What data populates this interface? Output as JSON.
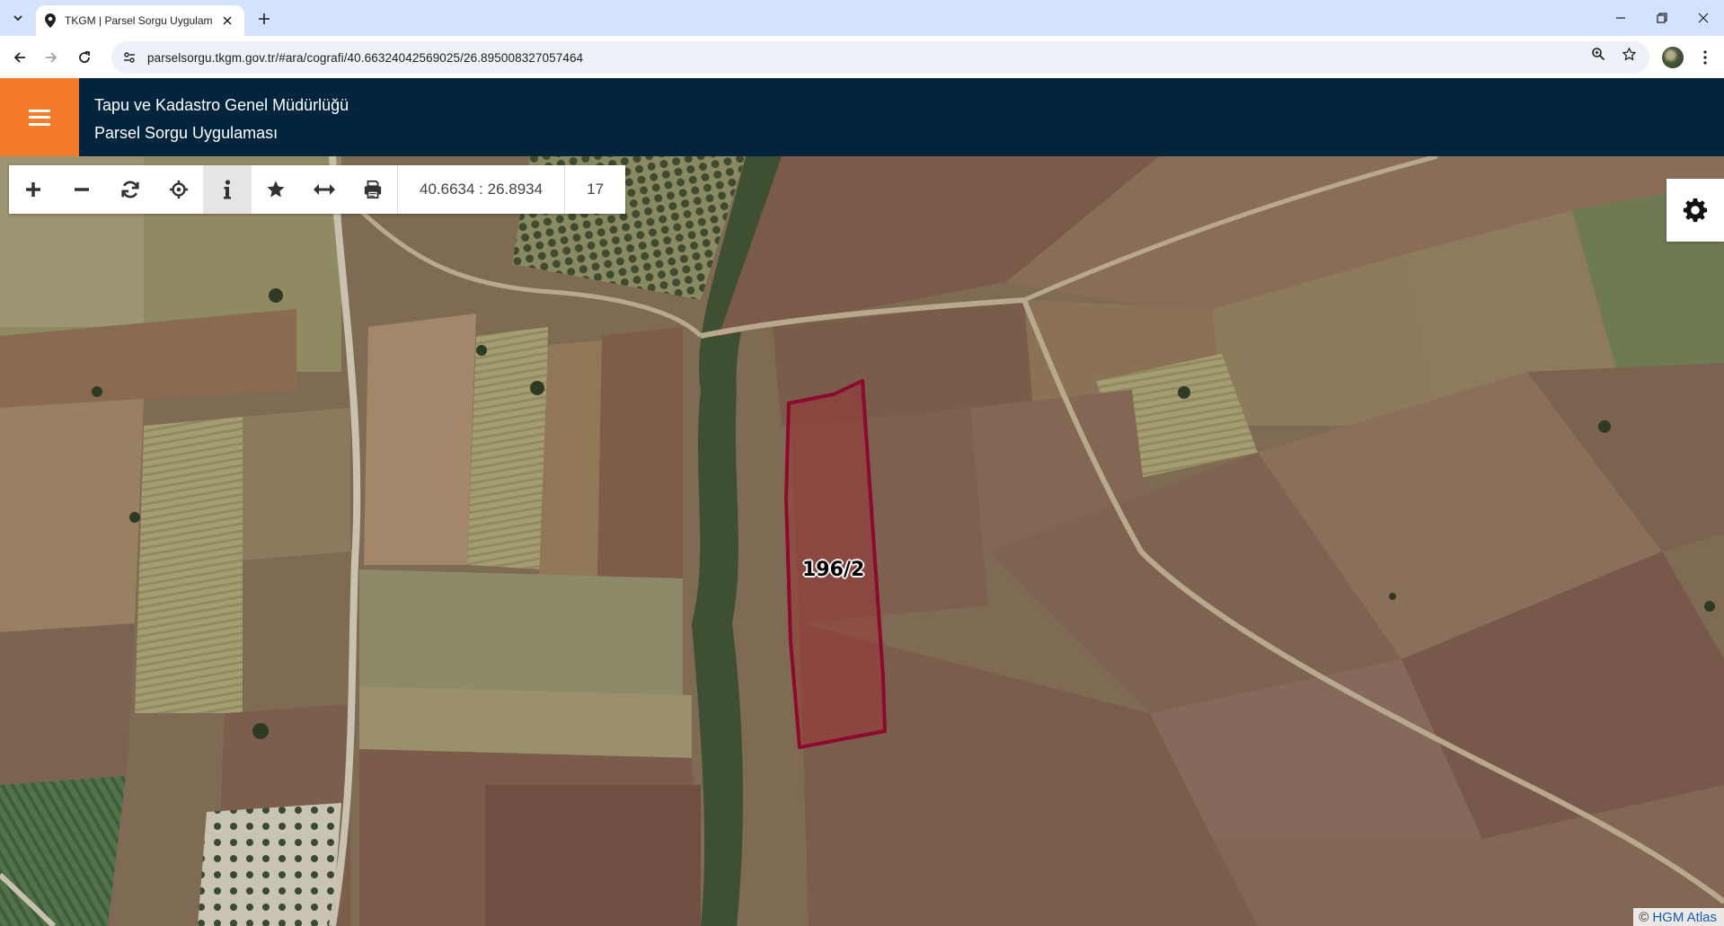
{
  "browser": {
    "tab_title": "TKGM | Parsel Sorgu Uygulaması",
    "url": "parselsorgu.tkgm.gov.tr/#ara/cografi/40.66324042569025/26.895008327057464"
  },
  "header": {
    "line1": "Tapu ve Kadastro Genel Müdürlüğü",
    "line2": "Parsel Sorgu Uygulaması",
    "colors": {
      "background": "#02253d",
      "menu_button": "#f47a2c"
    }
  },
  "toolbar": {
    "tools": [
      {
        "icon": "zoom-in-icon",
        "active": false
      },
      {
        "icon": "zoom-out-icon",
        "active": false
      },
      {
        "icon": "refresh-icon",
        "active": false
      },
      {
        "icon": "locate-icon",
        "active": false
      },
      {
        "icon": "info-icon",
        "active": true
      },
      {
        "icon": "star-icon",
        "active": false
      },
      {
        "icon": "measure-icon",
        "active": false
      },
      {
        "icon": "print-icon",
        "active": false
      }
    ],
    "coordinates": "40.6634 : 26.8934",
    "zoom_level": "17"
  },
  "map": {
    "parcel_label": "196/2",
    "parcel_color": "#8b0a2e",
    "attribution_symbol": "©",
    "attribution_link": "HGM Atlas"
  }
}
